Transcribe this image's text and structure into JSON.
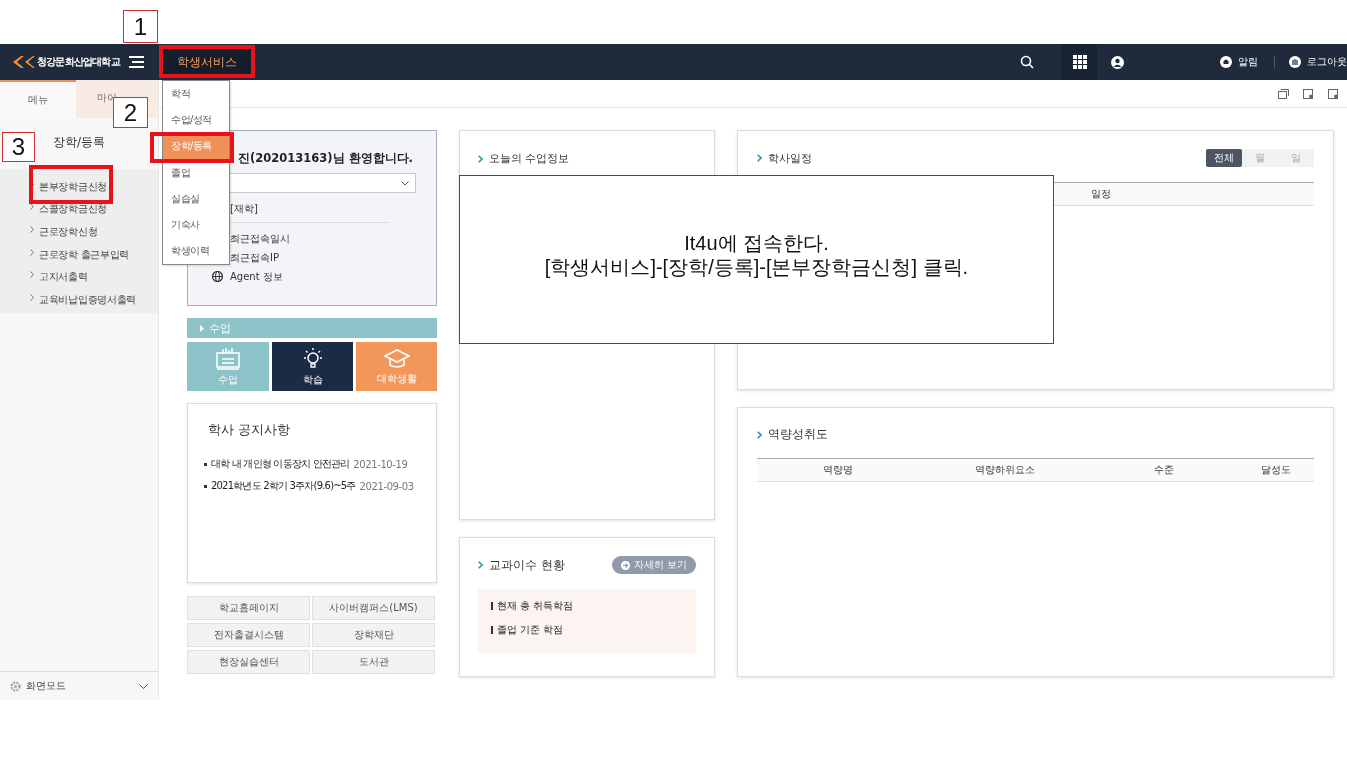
{
  "header": {
    "logo": "청강문화산업대학교",
    "nav": [
      {
        "label": "학생서비스",
        "selected": true,
        "highlighted": true
      }
    ],
    "alert": "알림",
    "logout": "로그아웃"
  },
  "nav_menu": {
    "items": [
      {
        "label": "학적",
        "selected": false,
        "highlighted": false
      },
      {
        "label": "수업/성적",
        "selected": false,
        "highlighted": false
      },
      {
        "label": "장학/등록",
        "selected": true,
        "highlighted": true
      },
      {
        "label": "졸업",
        "selected": false,
        "highlighted": false
      },
      {
        "label": "실습실",
        "selected": false,
        "highlighted": false
      },
      {
        "label": "기숙사",
        "selected": false,
        "highlighted": false
      },
      {
        "label": "학생이력",
        "selected": false,
        "highlighted": false
      }
    ]
  },
  "sidebar": {
    "tabs": [
      {
        "label": "메뉴",
        "selected": true
      },
      {
        "label": "마이",
        "selected": false
      }
    ],
    "section_title": "장학/등록",
    "items": [
      {
        "label": "본부장학금신청",
        "highlighted": true
      },
      {
        "label": "스콜장학금신청",
        "highlighted": false
      },
      {
        "label": "근로장학신청",
        "highlighted": false
      },
      {
        "label": "근로장학 출근부입력",
        "highlighted": false
      },
      {
        "label": "고지서출력",
        "highlighted": false
      },
      {
        "label": "교육비납입증명서출력",
        "highlighted": false
      }
    ],
    "screen_mode": "화면모드"
  },
  "profile": {
    "welcome": "진(202013163)님 환영합니다.",
    "status": "[재학]",
    "rows": [
      {
        "label": "최근접속일시",
        "kind": "plain"
      },
      {
        "label": "최근접속IP",
        "kind": "plain"
      },
      {
        "label": "Agent 정보",
        "kind": "agent"
      }
    ]
  },
  "class_panel": {
    "title": "수업",
    "tiles": [
      {
        "label": "수업",
        "kind": "class"
      },
      {
        "label": "학습",
        "kind": "study"
      },
      {
        "label": "대학생활",
        "kind": "campus"
      }
    ]
  },
  "notices": {
    "title": "학사 공지사항",
    "items": [
      {
        "title": "대학 내 개인형 이동장치 안전관리",
        "date": "2021-10-19"
      },
      {
        "title": "2021학년도 2학기 3주차(9.6)~5주",
        "date": "2021-09-03"
      }
    ]
  },
  "links": [
    "학교홈페이지",
    "사이버캠퍼스(LMS)",
    "전자출결시스템",
    "장학재단",
    "현장실습센터",
    "도서관"
  ],
  "today_class": {
    "title": "오늘의 수업정보"
  },
  "credits": {
    "title": "교과이수 현황",
    "button": "자세히 보기",
    "rows": [
      "현재 총 취득학점",
      "졸업 기준 학점"
    ]
  },
  "schedule": {
    "title": "학사일정",
    "tabs": [
      {
        "label": "전체",
        "selected": true
      },
      {
        "label": "월",
        "selected": false
      },
      {
        "label": "일",
        "selected": false
      }
    ],
    "columns": [
      "일정"
    ]
  },
  "competency": {
    "title": "역량성취도",
    "columns": [
      "역량명",
      "역량하위요소",
      "수준",
      "달성도"
    ]
  },
  "annotations": {
    "steps": [
      "1",
      "2",
      "3"
    ],
    "note": [
      "It4u에 접속한다.",
      "[학생서비스]-[장학/등록]-[본부장학금신청] 클릭."
    ]
  }
}
